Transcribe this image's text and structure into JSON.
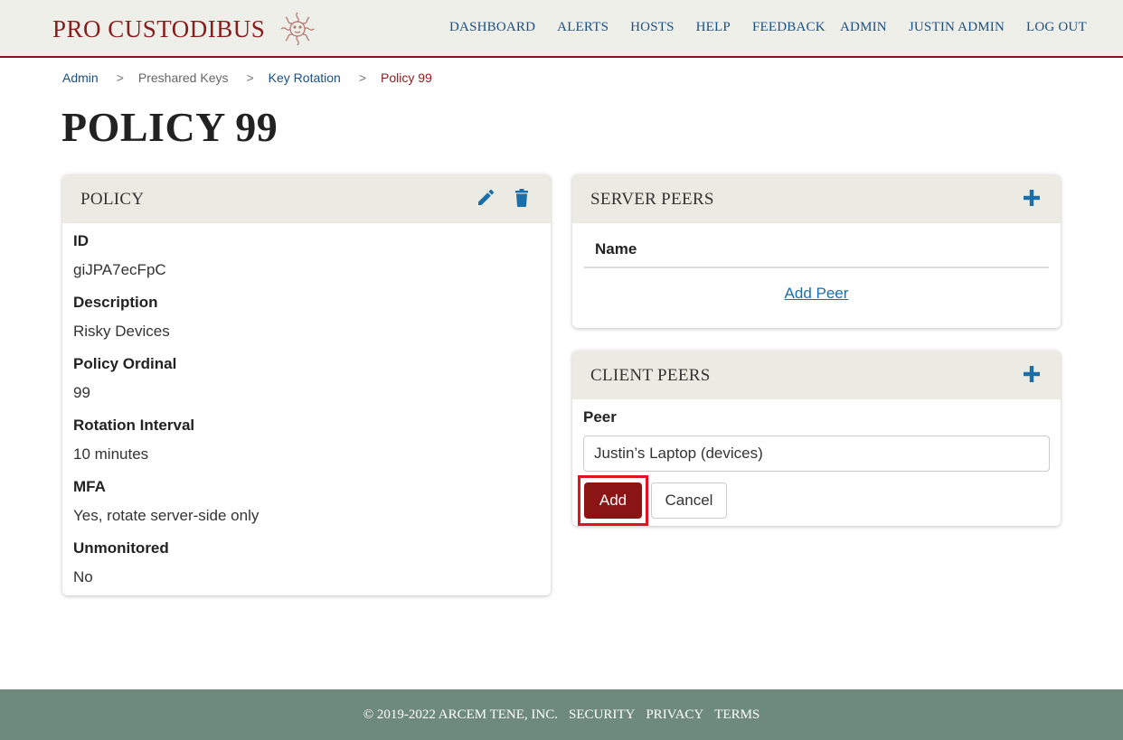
{
  "brand": {
    "name": "PRO CUSTODIBUS",
    "color": "#8b1c1c"
  },
  "nav": {
    "main": [
      "DASHBOARD",
      "ALERTS",
      "HOSTS",
      "HELP",
      "FEEDBACK"
    ],
    "user": [
      "ADMIN",
      "JUSTIN ADMIN",
      "LOG OUT"
    ]
  },
  "breadcrumb": {
    "items": [
      "Admin",
      "Preshared Keys",
      "Key Rotation",
      "Policy 99"
    ],
    "separator": ">"
  },
  "page": {
    "title": "POLICY 99"
  },
  "policy_card": {
    "title": "POLICY",
    "edit_icon": "pencil-icon",
    "delete_icon": "trash-icon",
    "fields": [
      {
        "label": "ID",
        "value": "giJPA7ecFpC"
      },
      {
        "label": "Description",
        "value": "Risky Devices"
      },
      {
        "label": "Policy Ordinal",
        "value": "99"
      },
      {
        "label": "Rotation Interval",
        "value": "10 minutes"
      },
      {
        "label": "MFA",
        "value": "Yes, rotate server-side only"
      },
      {
        "label": "Unmonitored",
        "value": "No"
      }
    ]
  },
  "server_peers": {
    "title": "SERVER PEERS",
    "add_icon": "plus-icon",
    "column_header": "Name",
    "add_link": "Add Peer"
  },
  "client_peers": {
    "title": "CLIENT PEERS",
    "add_icon": "plus-icon",
    "peer_label": "Peer",
    "peer_value": "Justin’s Laptop (devices)",
    "add_button": "Add",
    "cancel_button": "Cancel"
  },
  "footer": {
    "copyright": "© 2019-2022 ARCEM TENE, INC.",
    "links": [
      "SECURITY",
      "PRIVACY",
      "TERMS"
    ]
  },
  "colors": {
    "accent": "#8b1c1c",
    "link": "#1b4f80",
    "icon": "#1b6ea8",
    "footer": "#6e8a7e",
    "highlight": "#e0141e"
  }
}
